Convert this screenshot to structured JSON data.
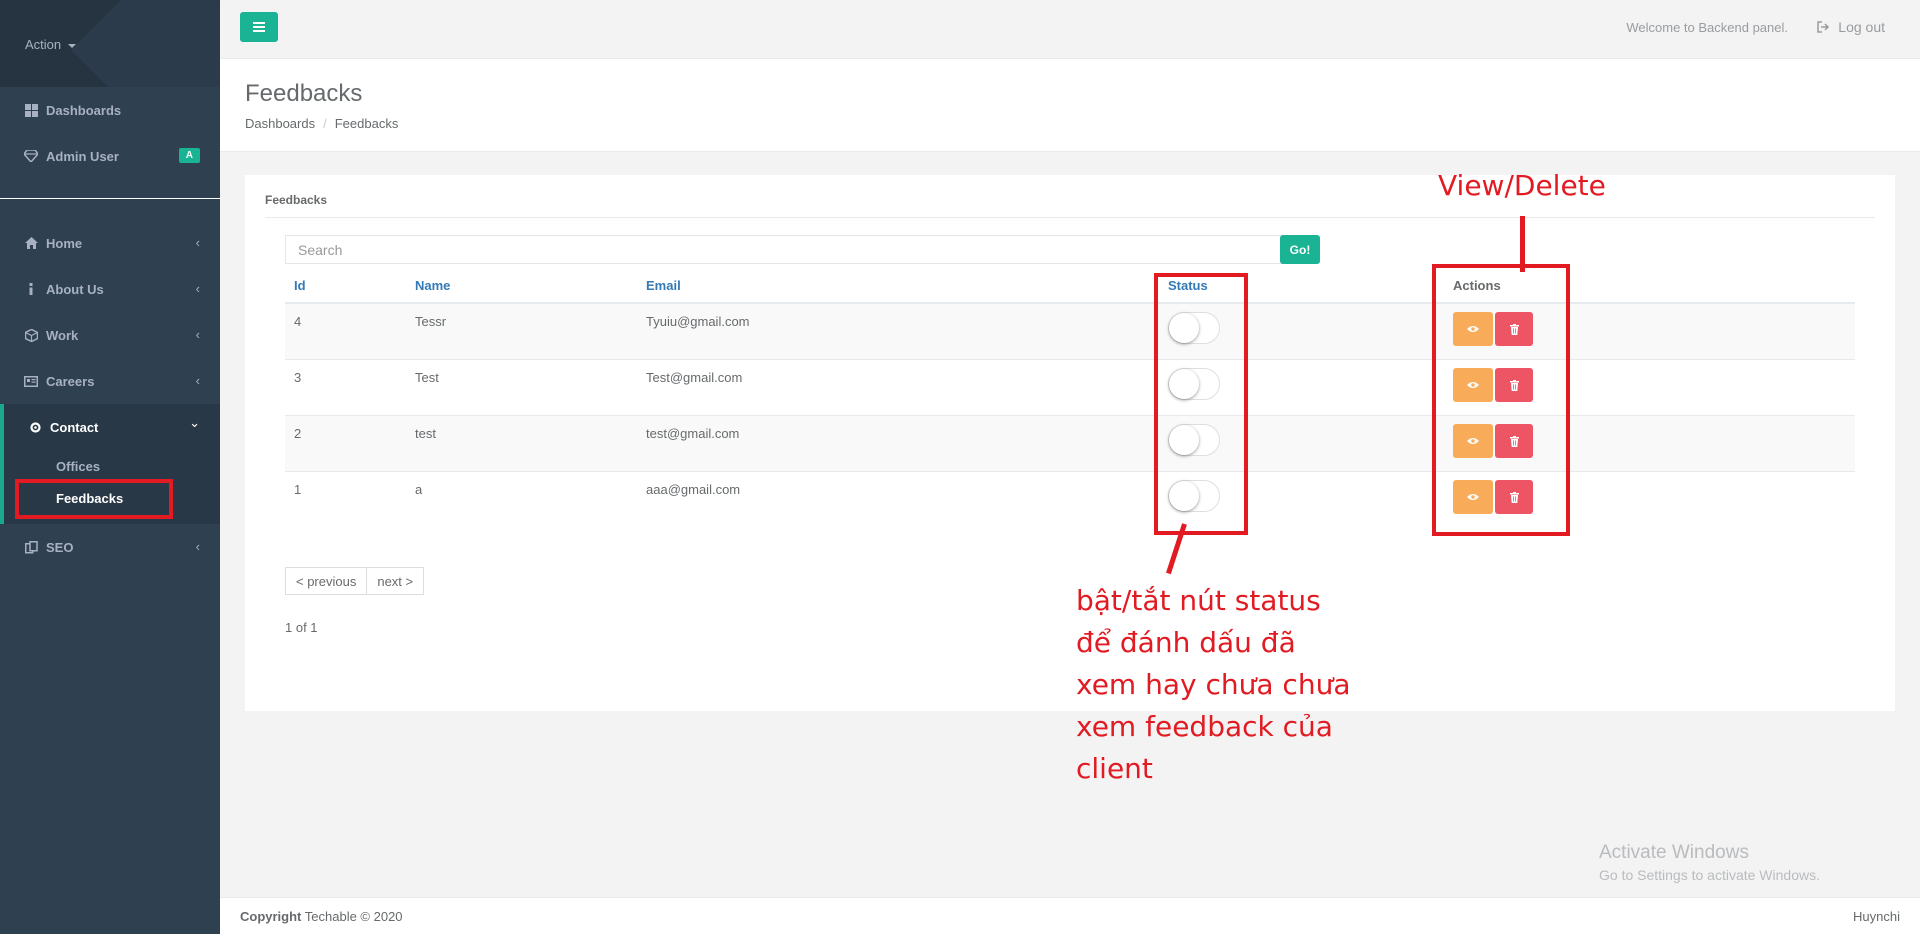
{
  "sidebar": {
    "action_label": "Action",
    "top_items": [
      {
        "label": "Dashboards",
        "icon": "th-large-icon"
      },
      {
        "label": "Admin User",
        "icon": "diamond-icon",
        "badge": "A"
      }
    ],
    "menu": [
      {
        "label": "Home",
        "icon": "home-icon",
        "arrow": "‹"
      },
      {
        "label": "About Us",
        "icon": "info-icon",
        "arrow": "‹"
      },
      {
        "label": "Work",
        "icon": "cube-icon",
        "arrow": "‹"
      },
      {
        "label": "Careers",
        "icon": "newspaper-icon",
        "arrow": "‹"
      },
      {
        "label": "Contact",
        "icon": "cog-icon",
        "arrow": "⌄"
      },
      {
        "label": "SEO",
        "icon": "sitemap-icon",
        "arrow": "‹"
      }
    ],
    "submenu": [
      {
        "label": "Offices"
      },
      {
        "label": "Feedbacks"
      }
    ]
  },
  "topbar": {
    "welcome": "Welcome to Backend panel.",
    "logout": "Log out"
  },
  "page": {
    "title": "Feedbacks",
    "breadcrumb": [
      "Dashboards",
      "Feedbacks"
    ]
  },
  "panel": {
    "title": "Feedbacks",
    "search_placeholder": "Search",
    "go_label": "Go!",
    "columns": {
      "id": "Id",
      "name": "Name",
      "email": "Email",
      "status": "Status",
      "actions": "Actions"
    },
    "rows": [
      {
        "id": "4",
        "name": "Tessr",
        "email": "Tyuiu@gmail.com",
        "status": false
      },
      {
        "id": "3",
        "name": "Test",
        "email": "Test@gmail.com",
        "status": false
      },
      {
        "id": "2",
        "name": "test",
        "email": "test@gmail.com",
        "status": false
      },
      {
        "id": "1",
        "name": "a",
        "email": "aaa@gmail.com",
        "status": false
      }
    ],
    "prev_label": "< previous",
    "next_label": "next >",
    "page_info": "1 of 1"
  },
  "annotations": {
    "view_delete": "View/Delete",
    "status_note": [
      "bật/tắt nút status",
      "để đánh dấu đã",
      "xem hay chưa chưa",
      "xem feedback của",
      "client"
    ]
  },
  "watermark": {
    "title": "Activate Windows",
    "subtitle": "Go to Settings to activate Windows."
  },
  "footer": {
    "copyright_bold": "Copyright",
    "copyright_rest": " Techable © 2020",
    "right": "Huynchi"
  },
  "colors": {
    "sidebar": "#2f4050",
    "accent": "#1ab394",
    "warning": "#f8ac59",
    "danger": "#ed5565",
    "annotation": "#e21b23"
  }
}
